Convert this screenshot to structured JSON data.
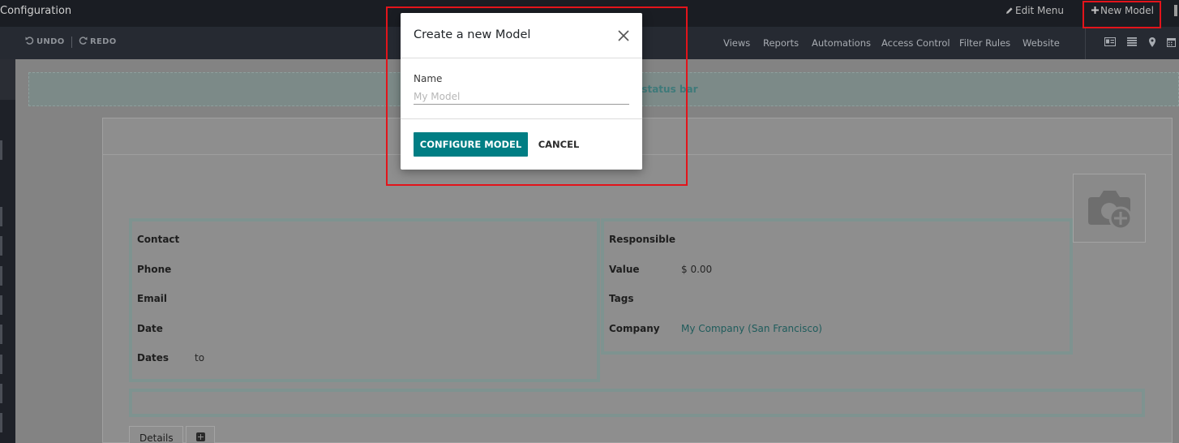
{
  "app": {
    "title": "Configuration"
  },
  "topbar": {
    "edit_menu": "Edit Menu",
    "new_model": "New Model"
  },
  "toolbar": {
    "undo": "UNDO",
    "redo": "REDO",
    "links": [
      "Views",
      "Reports",
      "Automations",
      "Access Control",
      "Filter Rules",
      "Website"
    ]
  },
  "view_switcher": {
    "icons": [
      "form-view-icon",
      "list-view-icon",
      "map-view-icon",
      "calendar-view-icon"
    ]
  },
  "statusbar": {
    "hint": "e status bar"
  },
  "form": {
    "left": [
      {
        "label": "Contact",
        "value": ""
      },
      {
        "label": "Phone",
        "value": ""
      },
      {
        "label": "Email",
        "value": ""
      },
      {
        "label": "Date",
        "value": ""
      },
      {
        "label": "Dates",
        "value": "to"
      }
    ],
    "right": [
      {
        "label": "Responsible",
        "value": ""
      },
      {
        "label": "Value",
        "value": "$ 0.00"
      },
      {
        "label": "Tags",
        "value": ""
      },
      {
        "label": "Company",
        "value": "My Company (San Francisco)"
      }
    ],
    "tabs": {
      "details": "Details"
    }
  },
  "modal": {
    "title": "Create a new Model",
    "name_label": "Name",
    "name_value": "",
    "name_placeholder": "My Model",
    "configure_label": "CONFIGURE MODEL",
    "cancel_label": "CANCEL"
  },
  "colors": {
    "primary": "#017e84",
    "highlight": "#e3141b",
    "navbar": "#1a1d23",
    "link": "#1f5c5c"
  }
}
